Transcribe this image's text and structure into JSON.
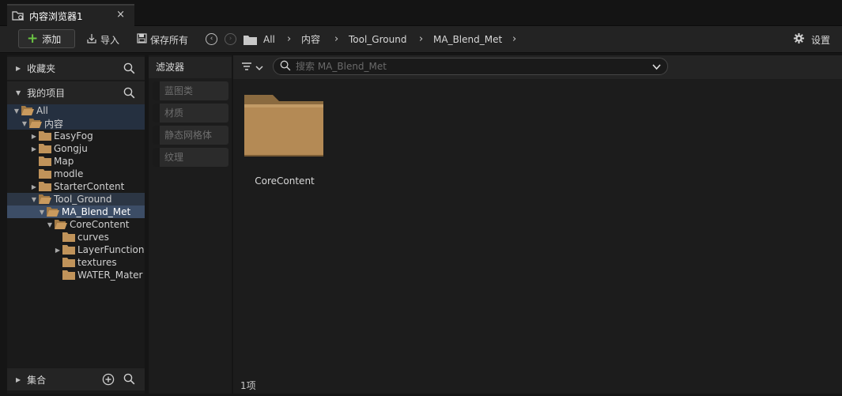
{
  "tab": {
    "title": "内容浏览器1",
    "close": "×"
  },
  "toolbar": {
    "add_label": "添加",
    "import_label": "导入",
    "save_all_label": "保存所有",
    "settings_label": "设置"
  },
  "breadcrumb": {
    "items": [
      "All",
      "内容",
      "Tool_Ground",
      "MA_Blend_Met"
    ],
    "separator": "›"
  },
  "sidebar": {
    "favorites_label": "收藏夹",
    "project_label": "我的项目",
    "collections_label": "集合",
    "tree": [
      {
        "label": "All",
        "state": "expanded"
      },
      {
        "label": "内容",
        "state": "expanded"
      },
      {
        "label": "EasyFog",
        "state": "collapsed"
      },
      {
        "label": "Gongju",
        "state": "collapsed"
      },
      {
        "label": "Map",
        "state": "leaf"
      },
      {
        "label": "modle",
        "state": "leaf"
      },
      {
        "label": "StarterContent",
        "state": "collapsed"
      },
      {
        "label": "Tool_Ground",
        "state": "expanded"
      },
      {
        "label": "MA_Blend_Met",
        "state": "expanded"
      },
      {
        "label": "CoreContent",
        "state": "expanded"
      },
      {
        "label": "curves",
        "state": "leaf"
      },
      {
        "label": "LayerFunction",
        "state": "collapsed"
      },
      {
        "label": "textures",
        "state": "leaf"
      },
      {
        "label": "WATER_Mater",
        "state": "leaf"
      }
    ]
  },
  "filters": {
    "title": "滤波器",
    "items": [
      "蓝图类",
      "材质",
      "静态网格体",
      "纹理"
    ]
  },
  "content": {
    "search_placeholder": "搜索 MA_Blend_Met",
    "assets": [
      {
        "name": "CoreContent",
        "type": "folder-icon"
      }
    ],
    "item_count": "1项"
  },
  "colors": {
    "accent_green": "#6ac443",
    "folder": "#b08a55",
    "selection": "#3c4d66"
  }
}
